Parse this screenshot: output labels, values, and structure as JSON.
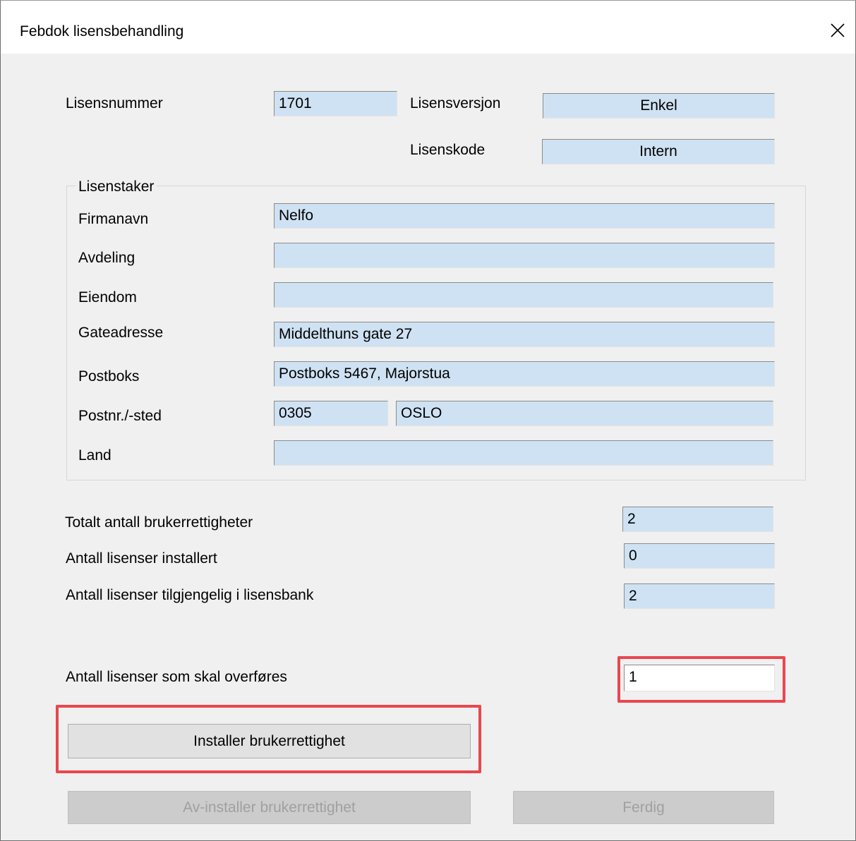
{
  "window": {
    "title": "Febdok lisensbehandling",
    "close_icon": "close-icon"
  },
  "license": {
    "number_label": "Lisensnummer",
    "number_value": "1701",
    "version_label": "Lisensversjon",
    "version_value": "Enkel",
    "code_label": "Lisenskode",
    "code_value": "Intern"
  },
  "licensee": {
    "group_label": "Lisenstaker",
    "company_label": "Firmanavn",
    "company_value": "Nelfo",
    "department_label": "Avdeling",
    "department_value": "",
    "property_label": "Eiendom",
    "property_value": "",
    "street_label": "Gateadresse",
    "street_value": "Middelthuns gate 27",
    "pobox_label": "Postboks",
    "pobox_value": "Postboks 5467, Majorstua",
    "postal_label": "Postnr./-sted",
    "postal_code_value": "0305",
    "postal_place_value": "OSLO",
    "country_label": "Land",
    "country_value": ""
  },
  "counts": {
    "total_label": "Totalt antall brukerrettigheter",
    "total_value": "2",
    "installed_label": "Antall lisenser installert",
    "installed_value": "0",
    "available_label": "Antall lisenser tilgjengelig i lisensbank",
    "available_value": "2",
    "transfer_label": "Antall lisenser som skal overføres",
    "transfer_value": "1"
  },
  "buttons": {
    "install": "Installer brukerrettighet",
    "uninstall": "Av-installer brukerrettighet",
    "done": "Ferdig"
  },
  "colors": {
    "field_bg": "#cfe2f3",
    "highlight": "#e8474e",
    "disabled_text": "#a0a0a0"
  }
}
